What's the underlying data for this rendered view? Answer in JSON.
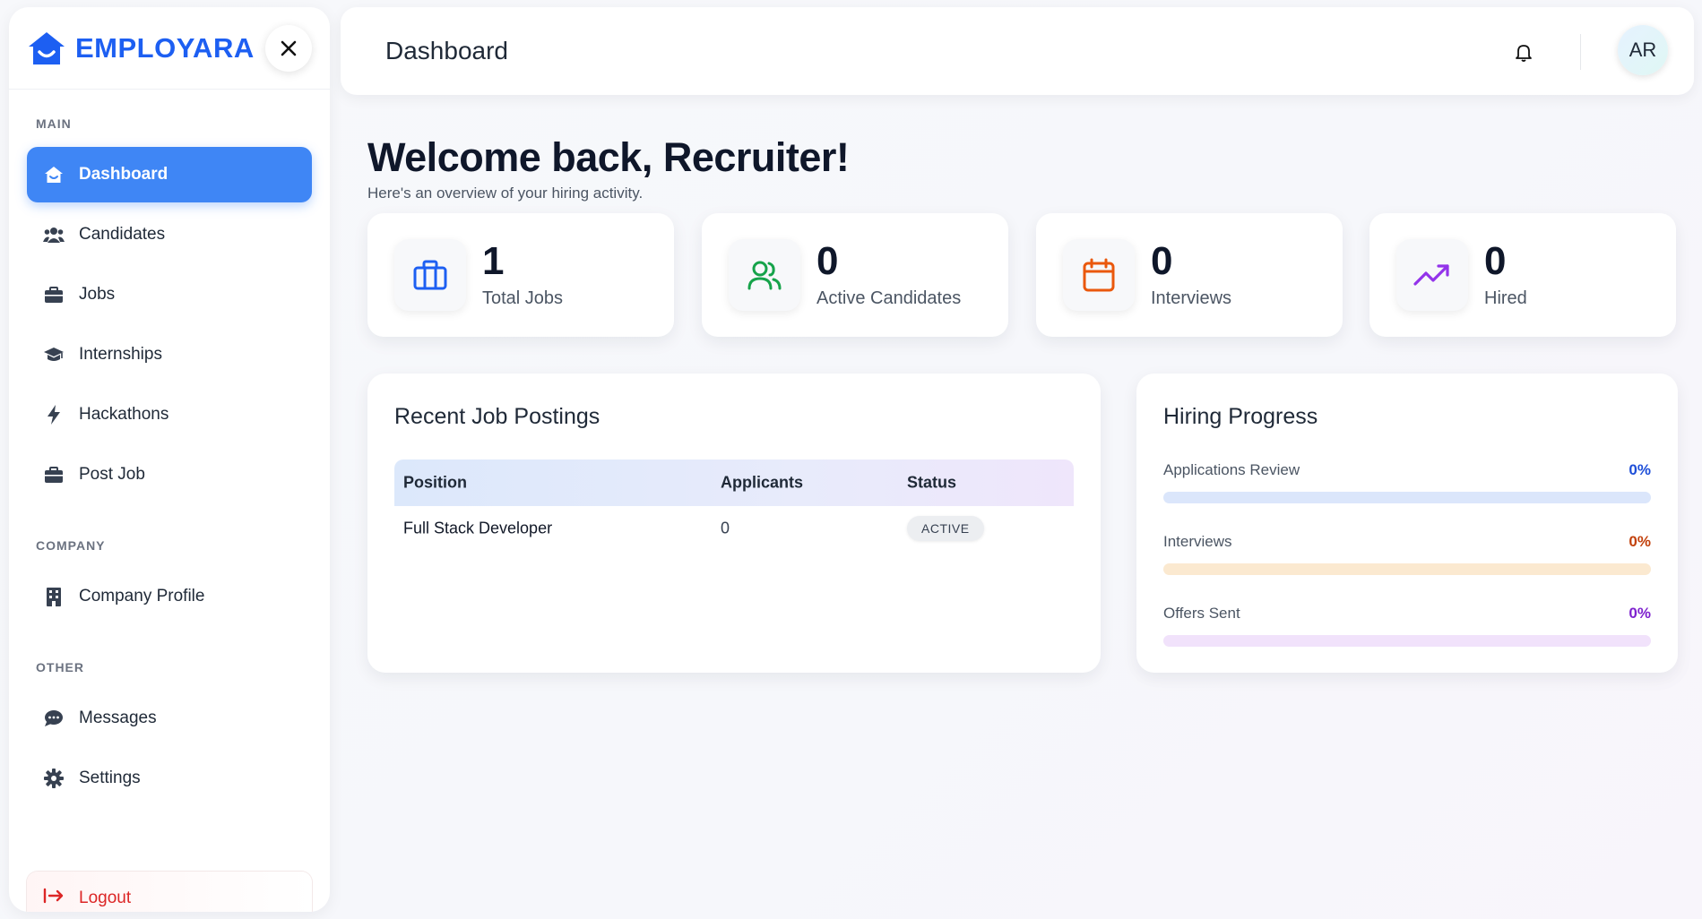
{
  "brand": {
    "name": "EMPLOYARA"
  },
  "sidebar": {
    "sections": {
      "main": "MAIN",
      "company": "COMPANY",
      "other": "OTHER"
    },
    "items": [
      {
        "label": "Dashboard",
        "icon": "home-icon",
        "active": true
      },
      {
        "label": "Candidates",
        "icon": "users-icon"
      },
      {
        "label": "Jobs",
        "icon": "briefcase-icon"
      },
      {
        "label": "Internships",
        "icon": "graduation-cap-icon"
      },
      {
        "label": "Hackathons",
        "icon": "bolt-icon"
      },
      {
        "label": "Post Job",
        "icon": "briefcase-icon"
      },
      {
        "label": "Company Profile",
        "icon": "building-icon"
      },
      {
        "label": "Messages",
        "icon": "chat-icon"
      },
      {
        "label": "Settings",
        "icon": "gear-icon"
      }
    ],
    "logout": "Logout"
  },
  "header": {
    "title": "Dashboard",
    "avatar_initials": "AR"
  },
  "welcome": {
    "title": "Welcome back, Recruiter!",
    "subtitle": "Here's an overview of your hiring activity."
  },
  "stats": [
    {
      "value": "1",
      "label": "Total Jobs",
      "icon": "briefcase-icon",
      "color": "#1d5ff2"
    },
    {
      "value": "0",
      "label": "Active Candidates",
      "icon": "users-icon",
      "color": "#16a34a"
    },
    {
      "value": "0",
      "label": "Interviews",
      "icon": "calendar-icon",
      "color": "#ea580c"
    },
    {
      "value": "0",
      "label": "Hired",
      "icon": "trending-up-icon",
      "color": "#9333ea"
    }
  ],
  "recent_postings": {
    "title": "Recent Job Postings",
    "columns": [
      "Position",
      "Applicants",
      "Status"
    ],
    "rows": [
      {
        "position": "Full Stack Developer",
        "applicants": "0",
        "status": "ACTIVE"
      }
    ]
  },
  "hiring_progress": {
    "title": "Hiring Progress",
    "items": [
      {
        "label": "Applications Review",
        "percent_text": "0%",
        "value": 0,
        "color": "#1d4ed8",
        "track": "#dbe6fb"
      },
      {
        "label": "Interviews",
        "percent_text": "0%",
        "value": 0,
        "color": "#c2410c",
        "track": "#fbe9d0"
      },
      {
        "label": "Offers Sent",
        "percent_text": "0%",
        "value": 0,
        "color": "#7e22ce",
        "track": "#f1e2fb"
      }
    ]
  }
}
